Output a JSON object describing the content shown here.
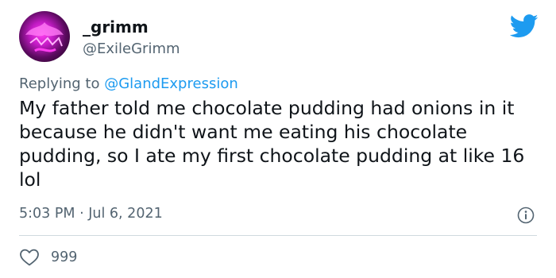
{
  "user": {
    "name": "_grimm",
    "handle": "@ExileGrimm"
  },
  "reply": {
    "prefix": "Replying to",
    "mention": "@GlandExpression"
  },
  "tweet": {
    "text": "My father told me chocolate pudding had onions in it because he didn't want me eating his chocolate pudding, so I ate my first chocolate pudding at like 16 lol",
    "time": "5:03 PM",
    "separator": "·",
    "date": "Jul 6, 2021"
  },
  "stats": {
    "likes": "999"
  },
  "icons": {
    "brand": "twitter-bird-icon",
    "info": "info-icon",
    "like": "heart-icon"
  },
  "colors": {
    "accent": "#1d9bf0",
    "secondary_text": "#536471",
    "primary_text": "#0f1419",
    "divider": "#cfd9de",
    "avatar": "#c21bc4"
  }
}
